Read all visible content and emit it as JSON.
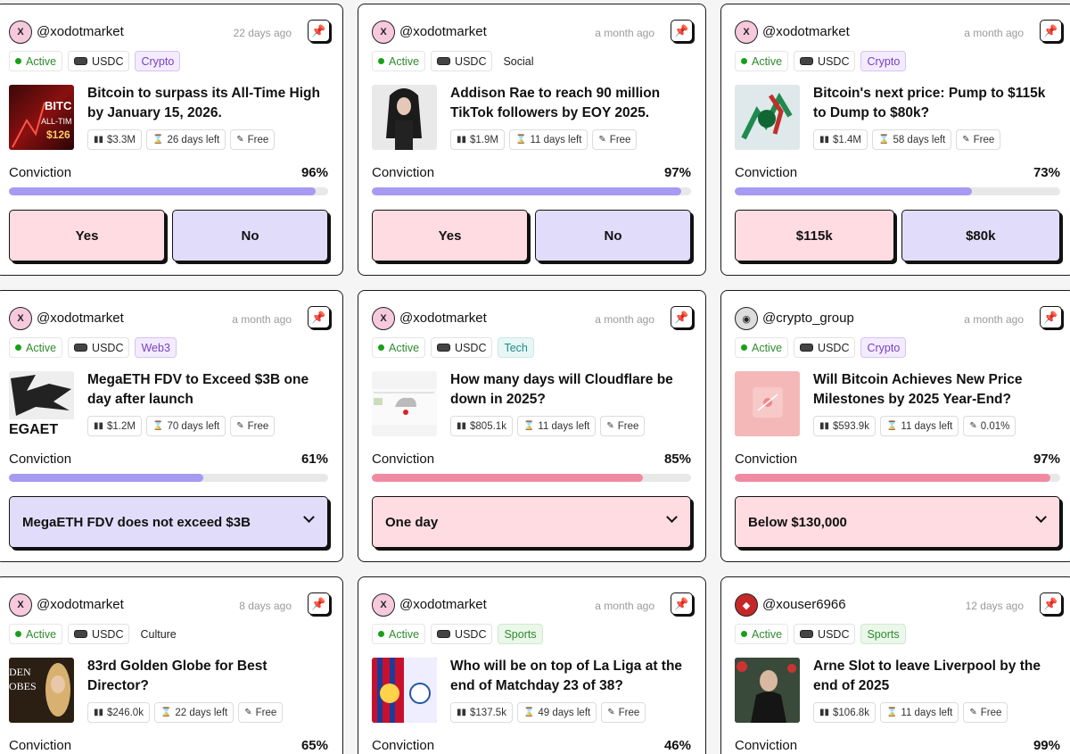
{
  "cards": [
    {
      "user": "@xodotmarket",
      "age": "22 days ago",
      "status": "Active",
      "currency": "USDC",
      "category": "Crypto",
      "title": "Bitcoin to surpass its All-Time High by January 15, 2026.",
      "volume": "$3.3M",
      "time_left": "26 days left",
      "fee": "Free",
      "conviction_label": "Conviction",
      "conviction": "96%",
      "conviction_value": 96,
      "option_a": "Yes",
      "option_b": "No"
    },
    {
      "user": "@xodotmarket",
      "age": "a month ago",
      "status": "Active",
      "currency": "USDC",
      "category": "Social",
      "title": "Addison Rae to reach 90 million TikTok followers by EOY 2025.",
      "volume": "$1.9M",
      "time_left": "11 days left",
      "fee": "Free",
      "conviction_label": "Conviction",
      "conviction": "97%",
      "conviction_value": 97,
      "option_a": "Yes",
      "option_b": "No"
    },
    {
      "user": "@xodotmarket",
      "age": "a month ago",
      "status": "Active",
      "currency": "USDC",
      "category": "Crypto",
      "title": "Bitcoin's next price: Pump to $115k to Dump to $80k?",
      "volume": "$1.4M",
      "time_left": "58 days left",
      "fee": "Free",
      "conviction_label": "Conviction",
      "conviction": "73%",
      "conviction_value": 73,
      "option_a": "$115k",
      "option_b": "$80k"
    },
    {
      "user": "@xodotmarket",
      "age": "a month ago",
      "status": "Active",
      "currency": "USDC",
      "category": "Web3",
      "title": "MegaETH FDV to Exceed $3B one day after launch",
      "volume": "$1.2M",
      "time_left": "70 days left",
      "fee": "Free",
      "conviction_label": "Conviction",
      "conviction": "61%",
      "conviction_value": 61,
      "selected": "MegaETH FDV does not exceed $3B"
    },
    {
      "user": "@xodotmarket",
      "age": "a month ago",
      "status": "Active",
      "currency": "USDC",
      "category": "Tech",
      "title": "How many days will Cloudflare be down in 2025?",
      "volume": "$805.1k",
      "time_left": "11 days left",
      "fee": "Free",
      "conviction_label": "Conviction",
      "conviction": "85%",
      "conviction_value": 85,
      "selected": "One day"
    },
    {
      "user": "@crypto_group",
      "age": "a month ago",
      "status": "Active",
      "currency": "USDC",
      "category": "Crypto",
      "title": "Will Bitcoin Achieves New Price Milestones by 2025 Year-End?",
      "volume": "$593.9k",
      "time_left": "11 days left",
      "fee": "0.01%",
      "conviction_label": "Conviction",
      "conviction": "97%",
      "conviction_value": 97,
      "selected": "Below $130,000"
    },
    {
      "user": "@xodotmarket",
      "age": "8 days ago",
      "status": "Active",
      "currency": "USDC",
      "category": "Culture",
      "title": "83rd Golden Globe for Best Director?",
      "volume": "$246.0k",
      "time_left": "22 days left",
      "fee": "Free",
      "conviction_label": "Conviction",
      "conviction": "65%"
    },
    {
      "user": "@xodotmarket",
      "age": "a month ago",
      "status": "Active",
      "currency": "USDC",
      "category": "Sports",
      "title": "Who will be on top of La Liga at the end of Matchday 23 of 38?",
      "volume": "$137.5k",
      "time_left": "49 days left",
      "fee": "Free",
      "conviction_label": "Conviction",
      "conviction": "46%"
    },
    {
      "user": "@xouser6966",
      "age": "12 days ago",
      "status": "Active",
      "currency": "USDC",
      "category": "Sports",
      "title": "Arne Slot to leave Liverpool by the end of 2025",
      "volume": "$106.8k",
      "time_left": "11 days left",
      "fee": "Free",
      "conviction_label": "Conviction",
      "conviction": "99%"
    }
  ],
  "icons": {
    "pin": "pin-icon",
    "volume": "bar-chart-icon",
    "time": "hourglass-icon",
    "fee": "ticket-icon",
    "currency": "coin-icon",
    "dropdown": "chevron-down-icon"
  },
  "colors": {
    "active": "#18a018",
    "yes": "#ffdbe2",
    "no": "#e2dcfb",
    "fill_purple": "#a79af2",
    "fill_pink": "#f08aa2"
  }
}
